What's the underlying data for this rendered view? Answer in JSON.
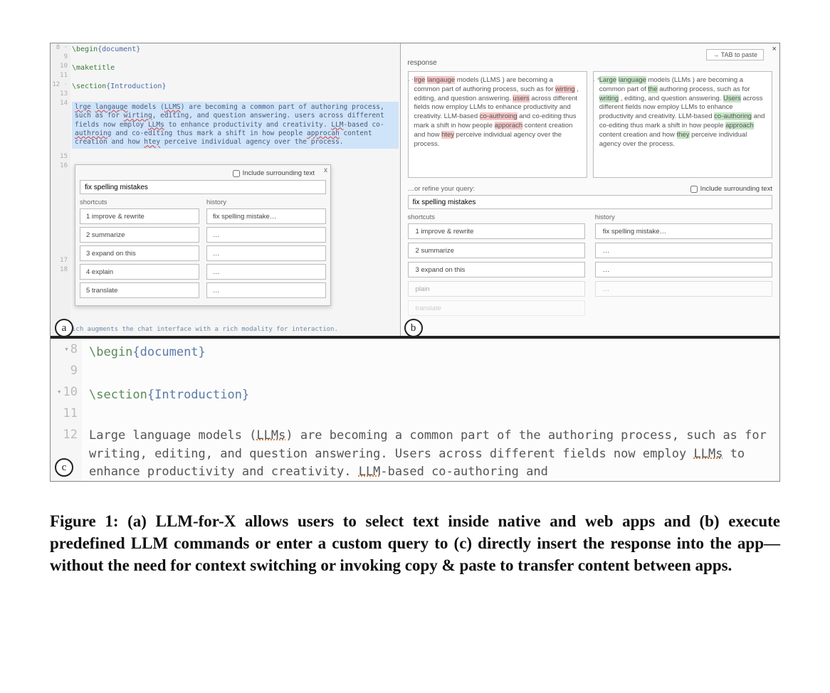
{
  "panelA": {
    "gutter": [
      "8 ·",
      "9",
      "10",
      "11",
      "12 ·",
      "13",
      "14"
    ],
    "gutter_tail": [
      "15",
      "16",
      "",
      "",
      "",
      "",
      "",
      "",
      "17",
      "18"
    ],
    "lines": [
      {
        "cmd": "\\begin",
        "arg": "{document}"
      },
      {
        "cmd": "",
        "arg": ""
      },
      {
        "cmd": "\\maketitle",
        "arg": ""
      },
      {
        "cmd": "",
        "arg": ""
      },
      {
        "cmd": "\\section",
        "arg": "{Introduction}"
      },
      {
        "cmd": "",
        "arg": ""
      }
    ],
    "selected_text": "lrge langauge models (LLMS) are becoming a common part of authoring process, such as for wirting, editing, and question answering. users across different fields now employ LLMs to enhance productivity and creativity. LLM-based co-authroing and co-editing thus mark a shift in how people approcah content creation and how htey perceive individual agency over the process.",
    "popup": {
      "include_label": "Include surrounding text",
      "query_value": "fix spelling mistakes",
      "shortcuts_header": "shortcuts",
      "history_header": "history",
      "shortcuts": [
        "1  improve & rewrite",
        "2  summarize",
        "3  expand on this",
        "4  explain",
        "5  translate"
      ],
      "history": [
        "fix spelling mistake…",
        "…",
        "…",
        "…",
        "…"
      ]
    },
    "footline": "ich augments the chat interface with a rich modality for interaction."
  },
  "panelB": {
    "tab_hint": "→ TAB to paste",
    "response_label": "response",
    "left_response": "lrge langauge models (LLMS ) are becoming a common part of authoring process, such as for wirting , editing, and question answering. users across different fields now employ LLMs to enhance productivity and creativity. LLM-based co-authroing and co-editing thus mark a shift in how people apporach content creation and how htey perceive individual agency over the process.",
    "right_response": "Large language models (LLMs ) are becoming a common part of the authoring process, such as for writing , editing, and question answering. Users across different fields now employ LLMs to enhance productivity and creativity. LLM-based co-authoring and co-editing thus mark a shift in how people approach content creation and how they perceive individual agency over the process.",
    "refine_label": "…or refine your query:",
    "include_label": "Include surrounding text",
    "query_value": "fix spelling mistakes",
    "shortcuts_header": "shortcuts",
    "history_header": "history",
    "shortcuts": [
      "1  improve & rewrite",
      "2  summarize",
      "3  expand on this",
      "   plain",
      "   translate"
    ],
    "history": [
      "fix spelling mistake…",
      "…",
      "…",
      "…",
      ""
    ]
  },
  "panelC": {
    "gutter": [
      "8 ",
      "9",
      "10 ",
      "11",
      "12"
    ],
    "lines": {
      "l8_cmd": "\\begin",
      "l8_arg": "{document}",
      "l10_cmd": "\\section",
      "l10_arg": "{Introduction}",
      "body": "Large language models (LLMs) are becoming a common part of the authoring process, such as for writing, editing, and question answering. Users across different fields now employ LLMs to enhance productivity and creativity. LLM-based co-authoring and"
    }
  },
  "badges": {
    "a": "a",
    "b": "b",
    "c": "c"
  },
  "caption": {
    "prefix": "Figure 1: (a) ",
    "text": "LLM-for-X allows users to select text inside native and web apps and (b) execute predefined LLM commands or enter a custom query to (c) directly insert the response into the app—without the need for context switching or invoking copy & paste to transfer content between apps."
  }
}
